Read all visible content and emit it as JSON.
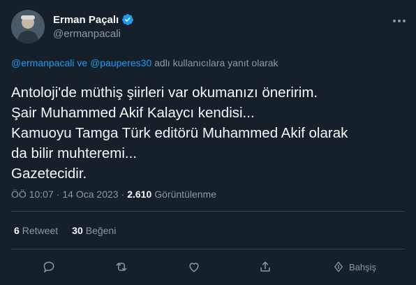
{
  "author": {
    "display_name": "Erman Paçalı",
    "handle": "@ermanpacali",
    "verified_icon": "verified-badge-icon"
  },
  "reply_context": {
    "mention1": "@ermanpacali",
    "connector": " ve ",
    "mention2": "@pauperes30",
    "suffix": " adlı kullanıcılara yanıt olarak"
  },
  "body_lines": [
    "Antoloji'de müthiş şiirleri var okumanızı öneririm.",
    "Şair Muhammed Akif Kalaycı kendisi...",
    "Kamuoyu Tamga Türk editörü Muhammed Akif olarak",
    "da bilir muhteremi...",
    "Gazetecidir."
  ],
  "meta": {
    "time": "ÖÖ 10:07",
    "separator1": "·",
    "date": "14 Oca 2023",
    "separator2": "·",
    "views_count": "2.610",
    "views_label": "Görüntülenme"
  },
  "stats": {
    "retweets_count": "6",
    "retweets_label": "Retweet",
    "likes_count": "30",
    "likes_label": "Beğeni"
  },
  "actions": {
    "share_label": "Bahşiş"
  },
  "colors": {
    "background": "#15202b",
    "accent": "#1d9bf0",
    "secondary_text": "#8b98a5",
    "primary_text": "#f7f9f9"
  }
}
